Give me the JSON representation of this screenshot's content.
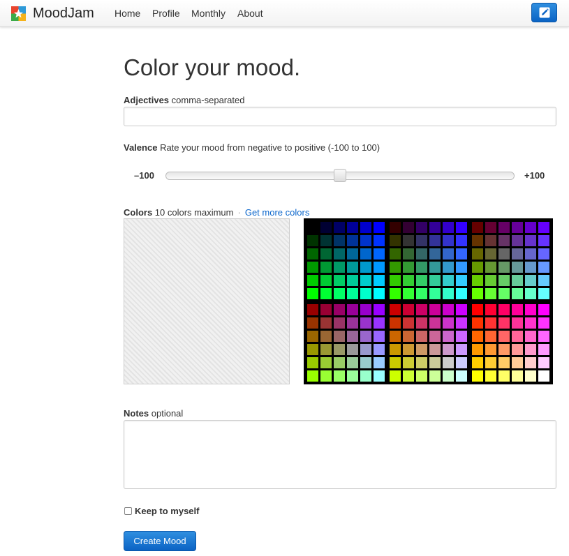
{
  "app": {
    "brand": "MoodJam",
    "logo_icon": "moodjam-logo-icon"
  },
  "nav": {
    "items": [
      {
        "label": "Home"
      },
      {
        "label": "Profile"
      },
      {
        "label": "Monthly"
      },
      {
        "label": "About"
      }
    ],
    "edit_icon": "pencil-icon"
  },
  "page": {
    "title": "Color your mood."
  },
  "adjectives": {
    "label": "Adjectives",
    "hint": "comma-separated",
    "value": ""
  },
  "valence": {
    "label": "Valence",
    "hint": "Rate your mood from negative to positive (-100 to 100)",
    "min_label": "–100",
    "max_label": "+100",
    "min": -100,
    "max": 100,
    "value": 0
  },
  "colors": {
    "label": "Colors",
    "hint": "10 colors maximum",
    "separator": "·",
    "link": "Get more colors",
    "selected": []
  },
  "notes": {
    "label": "Notes",
    "hint": "optional",
    "value": ""
  },
  "private": {
    "label": "Keep to myself",
    "checked": false
  },
  "submit": {
    "label": "Create Mood"
  },
  "theme": {
    "accent": "#0b63c4",
    "link": "#0a66cc",
    "palette_bg": "#000000"
  }
}
